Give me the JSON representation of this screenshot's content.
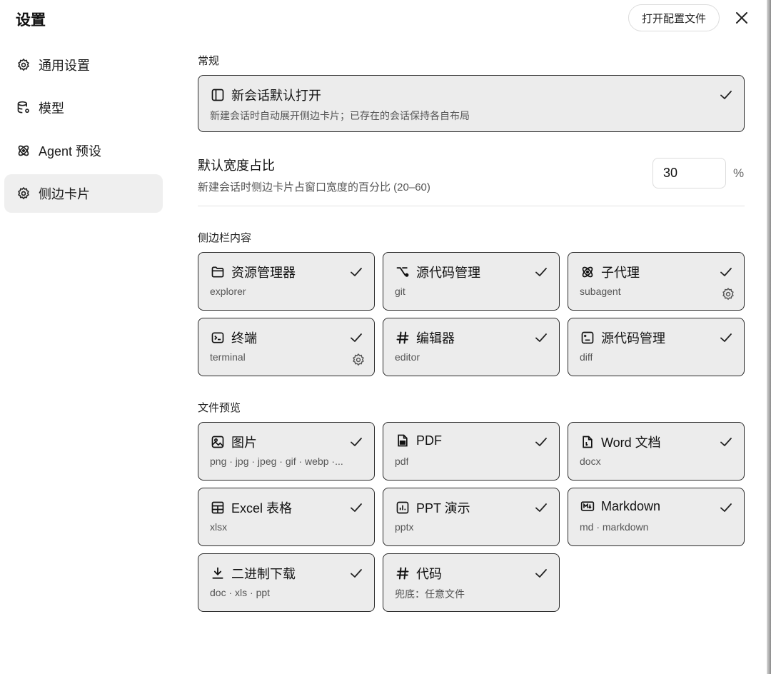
{
  "header": {
    "title": "设置",
    "open_config_label": "打开配置文件"
  },
  "sidebar": {
    "items": [
      {
        "label": "通用设置",
        "icon": "gear-icon"
      },
      {
        "label": "模型",
        "icon": "database-icon"
      },
      {
        "label": "Agent 预设",
        "icon": "atom-icon"
      },
      {
        "label": "侧边卡片",
        "icon": "gear-icon",
        "active": true
      }
    ]
  },
  "general": {
    "section_label": "常规",
    "new_session": {
      "title": "新会话默认打开",
      "desc": "新建会话时自动展开侧边卡片；已存在的会话保持各自布局",
      "checked": true
    },
    "width": {
      "title": "默认宽度占比",
      "desc": "新建会话时侧边卡片占窗口宽度的百分比 (20–60)",
      "value": "30",
      "unit": "%"
    }
  },
  "sidebar_content": {
    "section_label": "侧边栏内容",
    "cards": [
      {
        "title": "资源管理器",
        "sub": "explorer",
        "icon": "folder-icon",
        "checked": true,
        "gear": false
      },
      {
        "title": "源代码管理",
        "sub": "git",
        "icon": "git-branch-icon",
        "checked": true,
        "gear": false
      },
      {
        "title": "子代理",
        "sub": "subagent",
        "icon": "atom-icon",
        "checked": true,
        "gear": true
      },
      {
        "title": "终端",
        "sub": "terminal",
        "icon": "terminal-icon",
        "checked": true,
        "gear": true
      },
      {
        "title": "编辑器",
        "sub": "editor",
        "icon": "hash-icon",
        "checked": true,
        "gear": false
      },
      {
        "title": "源代码管理",
        "sub": "diff",
        "icon": "diff-icon",
        "checked": true,
        "gear": false
      }
    ]
  },
  "file_preview": {
    "section_label": "文件预览",
    "cards": [
      {
        "title": "图片",
        "sub": "png · jpg · jpeg · gif · webp ·...",
        "icon": "image-icon",
        "checked": true
      },
      {
        "title": "PDF",
        "sub": "pdf",
        "icon": "pdf-file-icon",
        "checked": true
      },
      {
        "title": "Word 文档",
        "sub": "docx",
        "icon": "word-file-icon",
        "checked": true
      },
      {
        "title": "Excel 表格",
        "sub": "xlsx",
        "icon": "table-icon",
        "checked": true
      },
      {
        "title": "PPT 演示",
        "sub": "pptx",
        "icon": "presentation-icon",
        "checked": true
      },
      {
        "title": "Markdown",
        "sub": "md · markdown",
        "icon": "markdown-icon",
        "checked": true
      },
      {
        "title": "二进制下载",
        "sub": "doc · xls · ppt",
        "icon": "download-icon",
        "checked": true
      },
      {
        "title": "代码",
        "sub": "兜底：任意文件",
        "icon": "hash-icon",
        "checked": true
      }
    ]
  }
}
